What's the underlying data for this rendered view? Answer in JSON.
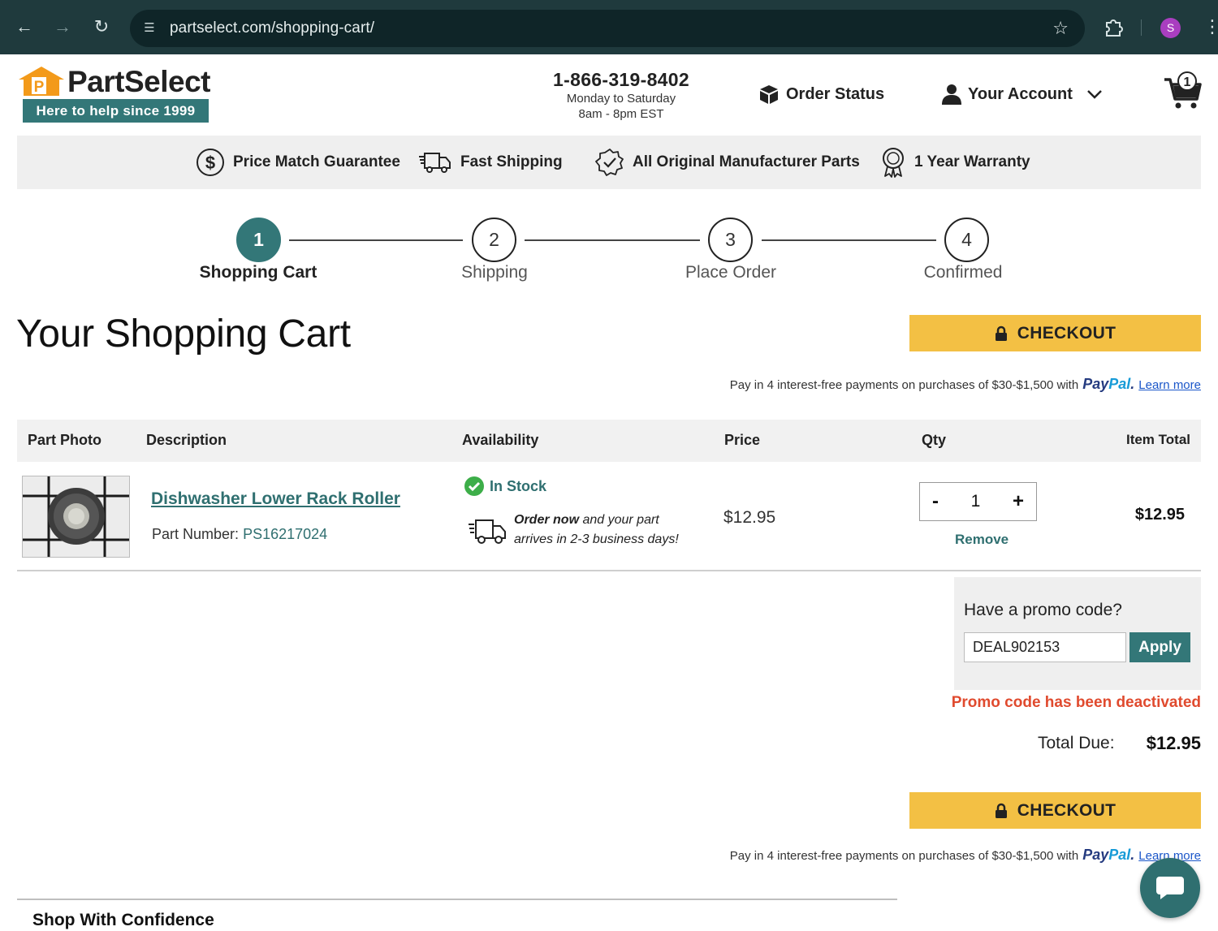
{
  "browser": {
    "url": "partselect.com/shopping-cart/",
    "profile_initial": "S",
    "icons": [
      "back-arrow",
      "forward-arrow",
      "reload",
      "site-info",
      "bookmark-star",
      "extensions-puzzle",
      "kebab-menu"
    ]
  },
  "header": {
    "brand": "PartSelect",
    "tagline": "Here to help since 1999",
    "phone": "1-866-319-8402",
    "hours_days": "Monday to Saturday",
    "hours_time": "8am - 8pm EST",
    "order_status": "Order Status",
    "your_account": "Your Account",
    "cart_count": "1"
  },
  "benefits": [
    {
      "label": "Price Match Guarantee",
      "icon": "dollar-circle-icon"
    },
    {
      "label": "Fast Shipping",
      "icon": "truck-icon"
    },
    {
      "label": "All Original Manufacturer Parts",
      "icon": "badge-check-icon"
    },
    {
      "label": "1 Year Warranty",
      "icon": "ribbon-award-icon"
    }
  ],
  "steps": [
    {
      "num": "1",
      "label": "Shopping Cart",
      "active": true
    },
    {
      "num": "2",
      "label": "Shipping",
      "active": false
    },
    {
      "num": "3",
      "label": "Place Order",
      "active": false
    },
    {
      "num": "4",
      "label": "Confirmed",
      "active": false
    }
  ],
  "page_title": "Your Shopping Cart",
  "checkout_label": "CHECKOUT",
  "paypal": {
    "text": "Pay in 4 interest-free payments on purchases of $30-$1,500 with",
    "brand_pay": "Pay",
    "brand_pal": "Pal",
    "learn_more": "Learn more"
  },
  "table": {
    "headers": [
      "Part Photo",
      "Description",
      "Availability",
      "Price",
      "Qty",
      "Item Total"
    ],
    "item": {
      "name": "Dishwasher Lower Rack Roller",
      "part_number_label": "Part Number:",
      "part_number": "PS16217024",
      "stock": "In Stock",
      "ship_order_now": "Order now",
      "ship_rest": "and your part",
      "ship_line2": "arrives in 2-3 business days!",
      "price": "$12.95",
      "qty": "1",
      "qty_minus": "-",
      "qty_plus": "+",
      "remove": "Remove",
      "item_total": "$12.95"
    }
  },
  "promo": {
    "label": "Have a promo code?",
    "code": "DEAL902153",
    "apply": "Apply",
    "error": "Promo code has been deactivated"
  },
  "totals": {
    "label": "Total Due:",
    "value": "$12.95"
  },
  "footer": {
    "shop_with_confidence": "Shop With Confidence"
  },
  "colors": {
    "brand_teal": "#337778",
    "checkout_yellow": "#f3c044",
    "error_red": "#e04a2e",
    "chrome_bg": "#1f3a3d"
  }
}
